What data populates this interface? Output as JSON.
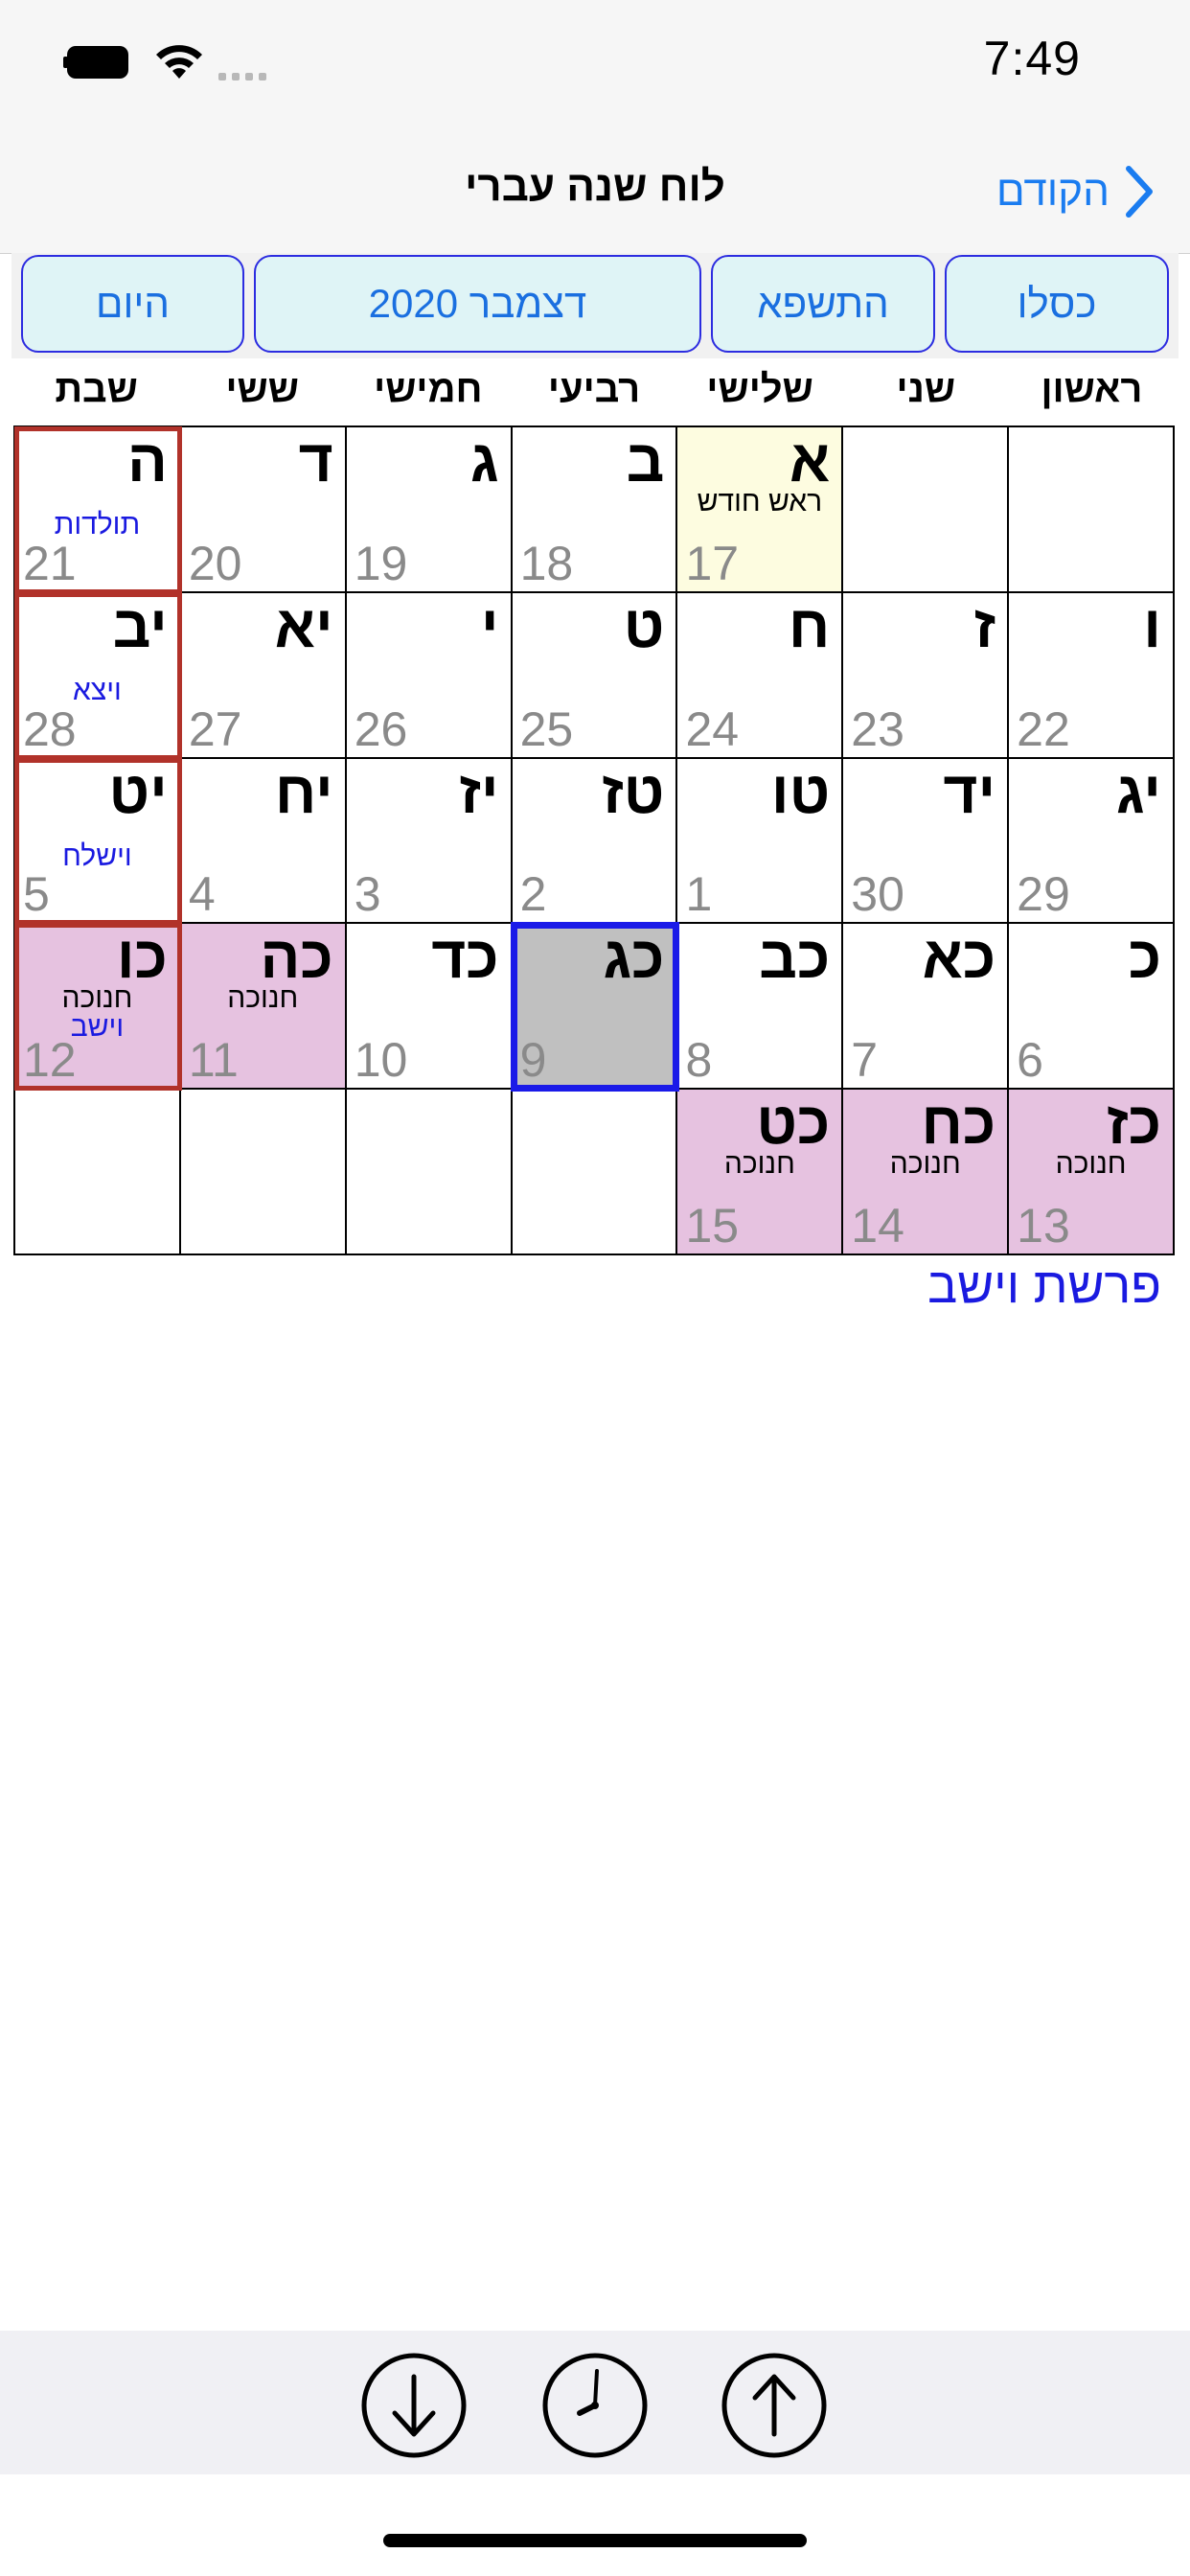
{
  "status_bar": {
    "time": "7:49"
  },
  "nav": {
    "title": "לוח שנה עברי",
    "back_label": "הקודם"
  },
  "segments": {
    "month": "כסלו",
    "year": "התשפא",
    "gregorian": "דצמבר 2020",
    "today": "היום"
  },
  "weekdays": [
    "ראשון",
    "שני",
    "שלישי",
    "רביעי",
    "חמישי",
    "ששי",
    "שבת"
  ],
  "weeks": [
    [
      {
        "heb": "",
        "greg": ""
      },
      {
        "heb": "",
        "greg": ""
      },
      {
        "heb": "א",
        "greg": "17",
        "note": "ראש חודש",
        "type": "rosh"
      },
      {
        "heb": "ב",
        "greg": "18"
      },
      {
        "heb": "ג",
        "greg": "19"
      },
      {
        "heb": "ד",
        "greg": "20"
      },
      {
        "heb": "ה",
        "greg": "21",
        "parasha": "תולדות",
        "type": "shabbat"
      }
    ],
    [
      {
        "heb": "ו",
        "greg": "22"
      },
      {
        "heb": "ז",
        "greg": "23"
      },
      {
        "heb": "ח",
        "greg": "24"
      },
      {
        "heb": "ט",
        "greg": "25"
      },
      {
        "heb": "י",
        "greg": "26"
      },
      {
        "heb": "יא",
        "greg": "27"
      },
      {
        "heb": "יב",
        "greg": "28",
        "parasha": "ויצא",
        "type": "shabbat"
      }
    ],
    [
      {
        "heb": "יג",
        "greg": "29"
      },
      {
        "heb": "יד",
        "greg": "30"
      },
      {
        "heb": "טו",
        "greg": "1"
      },
      {
        "heb": "טז",
        "greg": "2"
      },
      {
        "heb": "יז",
        "greg": "3"
      },
      {
        "heb": "יח",
        "greg": "4"
      },
      {
        "heb": "יט",
        "greg": "5",
        "parasha": "וישלח",
        "type": "shabbat"
      }
    ],
    [
      {
        "heb": "כ",
        "greg": "6"
      },
      {
        "heb": "כא",
        "greg": "7"
      },
      {
        "heb": "כב",
        "greg": "8"
      },
      {
        "heb": "כג",
        "greg": "9",
        "type": "today"
      },
      {
        "heb": "כד",
        "greg": "10"
      },
      {
        "heb": "כה",
        "greg": "11",
        "note": "חנוכה",
        "type": "holiday"
      },
      {
        "heb": "כו",
        "greg": "12",
        "note": "חנוכה",
        "parasha": "וישב",
        "type": "holiday-shabbat"
      }
    ],
    [
      {
        "heb": "כז",
        "greg": "13",
        "note": "חנוכה",
        "type": "holiday"
      },
      {
        "heb": "כח",
        "greg": "14",
        "note": "חנוכה",
        "type": "holiday"
      },
      {
        "heb": "כט",
        "greg": "15",
        "note": "חנוכה",
        "type": "holiday"
      },
      {
        "heb": "",
        "greg": ""
      },
      {
        "heb": "",
        "greg": ""
      },
      {
        "heb": "",
        "greg": ""
      },
      {
        "heb": "",
        "greg": ""
      }
    ]
  ],
  "parasha_footer": "פרשת וישב",
  "toolbar": {
    "icons": [
      "arrow-down-circle-icon",
      "clock-icon",
      "arrow-up-circle-icon"
    ]
  },
  "colors": {
    "accent_blue": "#1a7cf0",
    "today_border": "#1a1ae8",
    "shabbat_border": "#b1322a",
    "holiday_bg": "#e6c2e0",
    "rosh_chodesh_bg": "#fdfce0",
    "segment_bg": "#dff4f6"
  }
}
